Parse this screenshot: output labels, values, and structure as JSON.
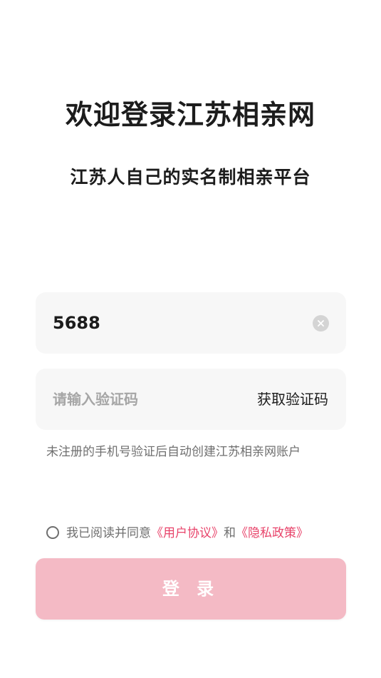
{
  "header": {
    "title": "欢迎登录江苏相亲网",
    "subtitle": "江苏人自己的实名制相亲平台"
  },
  "phone_field": {
    "value": "5688",
    "clear_icon": "clear-circle-icon"
  },
  "code_field": {
    "placeholder": "请输入验证码",
    "get_code_label": "获取验证码"
  },
  "hint": "未注册的手机号验证后自动创建江苏相亲网账户",
  "agreement": {
    "checked": false,
    "prefix": "我已阅读并同意",
    "user_agreement": "《用户协议》",
    "conjunction": "和",
    "privacy_policy": "《隐私政策》"
  },
  "login_button": {
    "label": "登 录"
  },
  "colors": {
    "accent": "#e8436a",
    "button_disabled": "#f4bac5",
    "field_bg": "#f7f7f7"
  }
}
